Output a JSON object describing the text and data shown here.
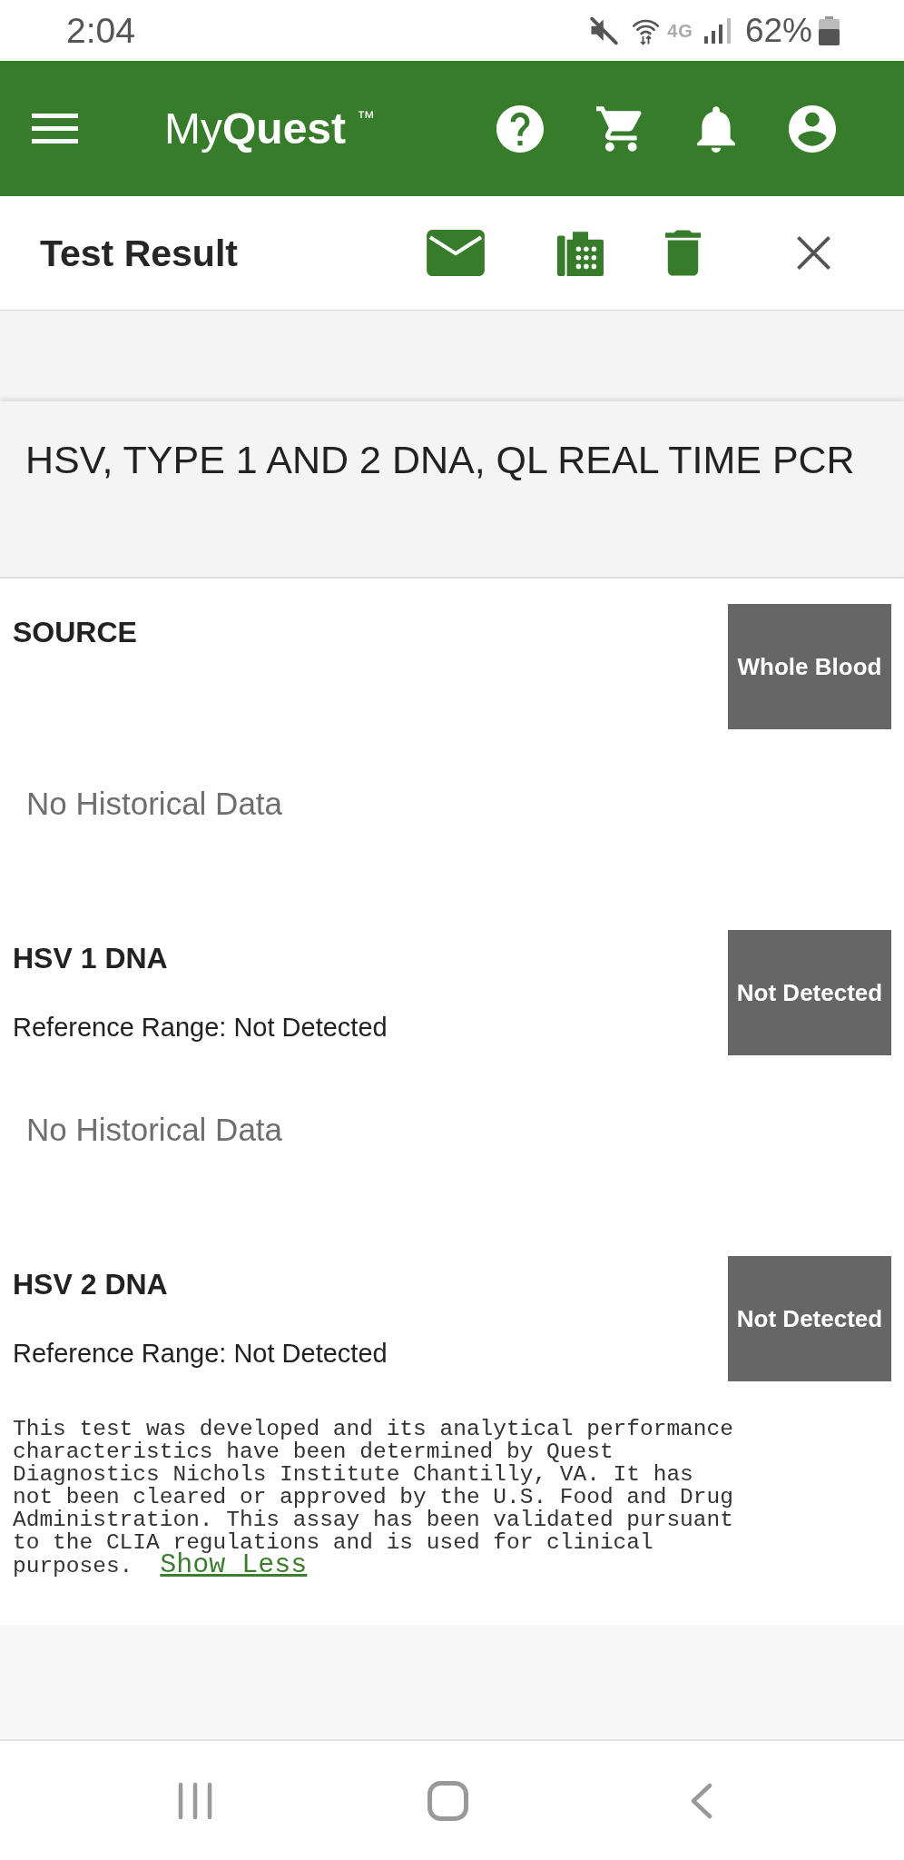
{
  "status_bar": {
    "time": "2:04",
    "network_type": "4G",
    "battery": "62%"
  },
  "app_bar": {
    "logo": "My**Quest**$^{™}$"
  },
  "header": {
    "title": "Test Result"
  },
  "test": {
    "name": "HSV, TYPE 1 AND 2 DNA, QL REAL TIME PCR"
  },
  "results": [
    {
      "name": "SOURCE",
      "value": "Whole Blood",
      "history": "No Historical Data"
    },
    {
      "name": "HSV 1 DNA",
      "reference": "Reference Range: Not Detected",
      "value": "Not Detected",
      "history": "No Historical Data"
    },
    {
      "name": "HSV 2 DNA",
      "reference": "Reference Range: Not Detected",
      "value": "Not Detected",
      "note": "This test was developed and its analytical performance characteristics have been determined by Quest Diagnostics Nichols Institute Chantilly, VA. It has not been cleared or approved by the U.S. Food and Drug Administration. This assay has been validated pursuant to the CLIA regulations and is used for clinical purposes.",
      "note_link": "Show Less"
    }
  ]
}
